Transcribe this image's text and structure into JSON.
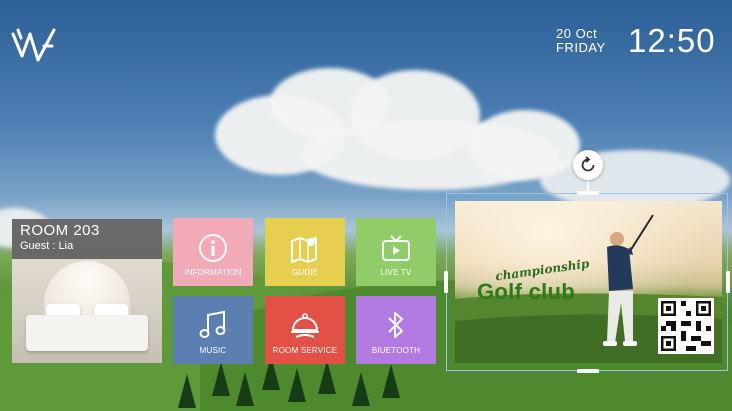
{
  "header": {
    "date_line1": "20 Oct",
    "date_line2": "FRIDAY",
    "time": "12:50"
  },
  "room": {
    "number": "ROOM 203",
    "guest": "Guest : Lia"
  },
  "tiles": [
    {
      "label": "INFORMATION",
      "color": "#f2a9b8",
      "icon": "info-icon"
    },
    {
      "label": "GUDIE",
      "color": "#e6cf4e",
      "icon": "map-pin-icon"
    },
    {
      "label": "LIVE TV",
      "color": "#90cc68",
      "icon": "tv-icon"
    },
    {
      "label": "MUSIC",
      "color": "#5a7fb0",
      "icon": "music-note-icon"
    },
    {
      "label": "ROOM SERVICE",
      "color": "#e25046",
      "icon": "cloche-icon"
    },
    {
      "label": "BIUETOOTH",
      "color": "#b07ae0",
      "icon": "bluetooth-icon"
    }
  ],
  "banner": {
    "script_text": "championship",
    "title": "Golf club"
  }
}
